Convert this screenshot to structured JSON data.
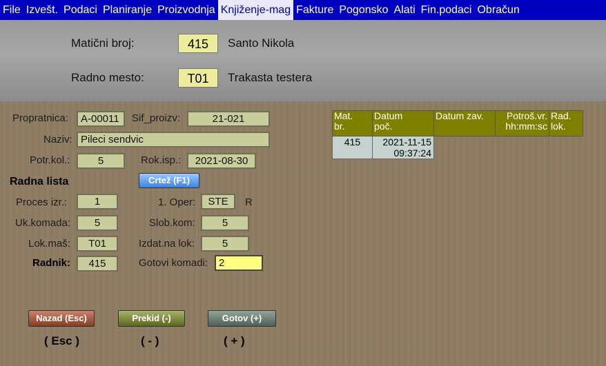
{
  "menu": [
    "File",
    "Izvešt.",
    "Podaci",
    "Planiranje",
    "Proizvodnja",
    "Knjiženje-mag",
    "Fakture",
    "Pogonsko",
    "Alati",
    "Fin.podaci",
    "Obračun"
  ],
  "header": {
    "maticni_label": "Matični broj:",
    "maticni_value": "415",
    "maticni_name": "Santo Nikola",
    "radno_label": "Radno mesto:",
    "radno_value": "T01",
    "radno_name": "Trakasta testera"
  },
  "form": {
    "propratnica_label": "Propratnica:",
    "propratnica": "A-00011",
    "sif_label": "Sif_proizv:",
    "sif": "21-021",
    "naziv_label": "Naziv:",
    "naziv": "Pileci sendvic",
    "potr_label": "Potr.kol.:",
    "potr": "5",
    "rok_label": "Rok.isp.:",
    "rok": "2021-08-30",
    "radna_lista": "Radna lista",
    "crtez": "Crtež (F1)",
    "proces_label": "Proces izr.:",
    "proces": "1",
    "oper_label": "1. Oper:",
    "oper": "STE",
    "oper_flag": "R",
    "uk_label": "Uk.komada:",
    "uk": "5",
    "slob_label": "Slob.kom:",
    "slob": "5",
    "lok_label": "Lok.maš:",
    "lok": "T01",
    "izdat_label": "Izdat.na lok:",
    "izdat": "5",
    "radnik_label": "Radnik:",
    "radnik": "415",
    "gotovi_label": "Gotovi komadi:",
    "gotovi": "2"
  },
  "table": {
    "headers": [
      [
        "Mat.",
        "br."
      ],
      [
        "Datum",
        "poč."
      ],
      [
        "Datum zav.",
        ""
      ],
      [
        "Potroš.vr.",
        "hh:mm:sc"
      ],
      [
        "Rad.",
        "lok."
      ]
    ],
    "row": {
      "mat": "415",
      "datum_date": "2021-11-15",
      "datum_time": "09:37:24",
      "zav": "",
      "potros": "",
      "lok": ""
    }
  },
  "buttons": {
    "nazad": "Nazad (Esc)",
    "prekid": "Prekid (-)",
    "gotov": "Gotov (+)"
  },
  "hints": {
    "esc": "( Esc )",
    "minus": "( - )",
    "plus": "( + )"
  }
}
